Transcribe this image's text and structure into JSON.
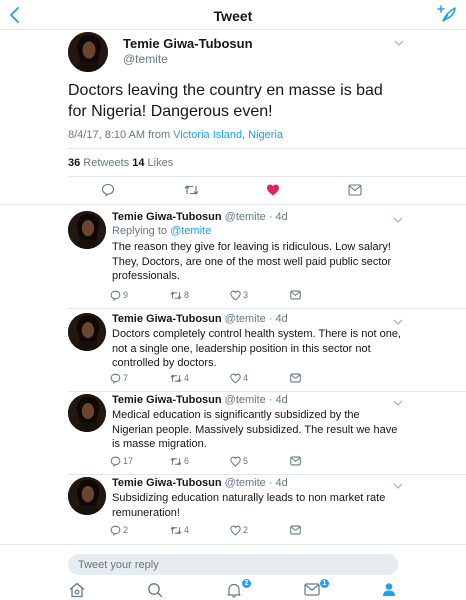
{
  "nav": {
    "title": "Tweet"
  },
  "tweet": {
    "name": "Temie Giwa-Tubosun",
    "handle": "@temite",
    "text": "Doctors leaving the country en masse is bad for Nigeria! Dangerous even!",
    "timestamp": "8/4/17, 8:10 AM from ",
    "location": "Victoria Island, Nigeria",
    "retweets_count": "36",
    "retweets_label": " Retweets ",
    "likes_count": "14",
    "likes_label": " Likes",
    "liked": true
  },
  "replies": [
    {
      "name": "Temie Giwa-Tubosun",
      "meta": " @temite · 4d",
      "replying_prefix": "Replying to ",
      "replying_handle": "@temite",
      "text": "The reason they give for leaving is ridiculous. Low salary! They, Doctors, are one of the most well paid public sector professionals.",
      "reply_count": "9",
      "retweet_count": "8",
      "like_count": "3"
    },
    {
      "name": "Temie Giwa-Tubosun",
      "meta": " @temite · 4d",
      "text": "Doctors completely control health system. There is not one, not a single one, leadership position in this sector not controlled by doctors.",
      "reply_count": "7",
      "retweet_count": "4",
      "like_count": "4"
    },
    {
      "name": "Temie Giwa-Tubosun",
      "meta": " @temite · 4d",
      "text": "Medical education is significantly subsidized by the Nigerian people. Massively subsidized. The result we have is masse migration.",
      "reply_count": "17",
      "retweet_count": "6",
      "like_count": "5"
    },
    {
      "name": "Temie Giwa-Tubosun",
      "meta": " @temite · 4d",
      "text": "Subsidizing education naturally leads to non market rate remuneration!",
      "reply_count": "2",
      "retweet_count": "4",
      "like_count": "2"
    }
  ],
  "reply_box": {
    "placeholder": "Tweet your reply"
  },
  "tabbar": {
    "notifications_badge": "2",
    "messages_badge": "1"
  },
  "colors": {
    "accent": "#1da1f2",
    "like": "#e0245e",
    "muted": "#657786"
  }
}
